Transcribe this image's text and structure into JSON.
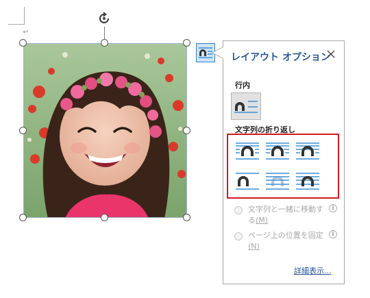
{
  "document": {
    "paragraph_mark": "↵",
    "anchor_mark": "⌟"
  },
  "picture": {
    "subject": "smiling-girl-flower-crown-photo"
  },
  "layout_button": {
    "icon": "layout-options-icon"
  },
  "panel": {
    "title": "レイアウト オプション",
    "close_icon": "close-icon",
    "inline_section": "行内",
    "wrap_section": "文字列の折り返し",
    "wrap_options": [
      "square-wrap-icon",
      "tight-wrap-icon",
      "through-wrap-icon",
      "top-bottom-wrap-icon",
      "behind-text-icon",
      "in-front-of-text-icon"
    ],
    "option_move": {
      "text": "文字列と一緒に移動する",
      "mnemonic": "(M)"
    },
    "option_fix": {
      "text": "ページ上の位置を固定",
      "mnemonic": "(N)"
    },
    "info_glyph": "i",
    "more_link": "詳細表示..."
  },
  "colors": {
    "accent": "#2b579a",
    "highlight_border": "#d0181f",
    "wrap_line_blue": "#3a8fd6"
  }
}
